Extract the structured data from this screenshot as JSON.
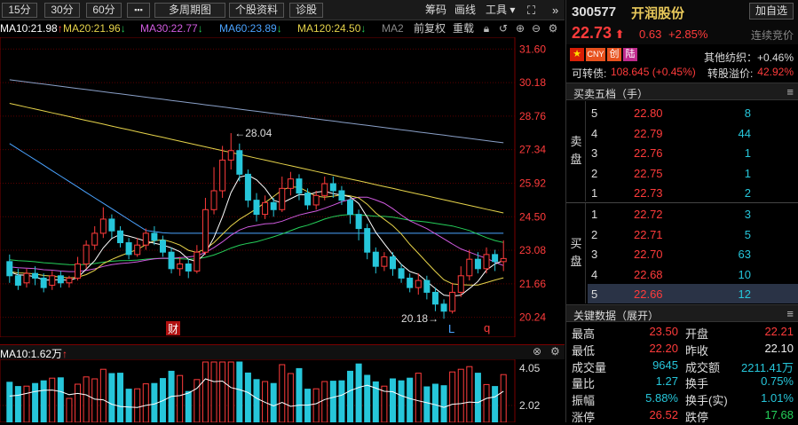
{
  "toolbar": {
    "periods": [
      "15分",
      "30分",
      "60分"
    ],
    "more": "▪▪▪",
    "multi_period": "多周期图",
    "stock_info": "个股资料",
    "diagnose": "诊股",
    "fund": "筹码",
    "draw": "画线",
    "tools": "工具"
  },
  "ma_bar": {
    "ma10": "MA10:21.98",
    "ma20": "MA20:21.96",
    "ma30": "MA30:22.77",
    "ma60": "MA60:23.89",
    "ma120": "MA120:24.50",
    "ma250": "MA2",
    "fq": "前复权",
    "reset": "重载"
  },
  "colors": {
    "up": "#ff3b3b",
    "down": "#26c6da",
    "ma10": "#ffffff",
    "ma20": "#e6d34a",
    "ma30": "#d15be0",
    "ma60": "#4aa3ff",
    "ma120": "#25d05a"
  },
  "chart_data": {
    "type": "candlestick",
    "y_ticks": [
      "31.60",
      "30.18",
      "28.76",
      "27.34",
      "25.92",
      "24.50",
      "23.08",
      "21.66",
      "20.24"
    ],
    "ylim": [
      19.4,
      32.1
    ],
    "annotations": {
      "high": "28.04",
      "low": "20.18"
    },
    "markers": [
      "财",
      "L",
      "q"
    ],
    "candles": [
      [
        22.6,
        22.0,
        22.9,
        21.7
      ],
      [
        22.0,
        21.6,
        22.3,
        21.4
      ],
      [
        21.7,
        22.1,
        22.3,
        21.5
      ],
      [
        22.1,
        21.9,
        22.4,
        21.6
      ],
      [
        21.9,
        21.5,
        22.1,
        21.3
      ],
      [
        21.6,
        22.0,
        22.2,
        21.4
      ],
      [
        22.0,
        21.7,
        22.2,
        21.5
      ],
      [
        21.7,
        21.9,
        22.0,
        21.5
      ],
      [
        21.9,
        22.5,
        22.8,
        21.8
      ],
      [
        22.5,
        23.3,
        23.5,
        22.3
      ],
      [
        23.3,
        23.8,
        24.1,
        23.1
      ],
      [
        23.8,
        24.4,
        24.9,
        23.6
      ],
      [
        24.4,
        23.9,
        24.6,
        23.6
      ],
      [
        23.9,
        23.4,
        24.1,
        23.2
      ],
      [
        23.4,
        22.9,
        23.6,
        22.7
      ],
      [
        22.9,
        23.3,
        23.6,
        22.8
      ],
      [
        23.3,
        23.8,
        24.0,
        23.1
      ],
      [
        23.8,
        23.5,
        24.1,
        23.3
      ],
      [
        23.5,
        23.0,
        23.7,
        22.8
      ],
      [
        23.0,
        22.3,
        23.2,
        22.1
      ],
      [
        22.3,
        22.5,
        22.8,
        22.0
      ],
      [
        22.5,
        22.2,
        22.7,
        21.9
      ],
      [
        22.2,
        23.0,
        23.3,
        22.1
      ],
      [
        23.0,
        24.8,
        25.3,
        22.9
      ],
      [
        24.8,
        25.6,
        26.6,
        24.6
      ],
      [
        25.6,
        26.9,
        27.5,
        25.3
      ],
      [
        26.9,
        27.3,
        28.04,
        26.5
      ],
      [
        27.3,
        26.3,
        27.6,
        26.0
      ],
      [
        26.3,
        25.2,
        26.5,
        24.9
      ],
      [
        25.2,
        24.6,
        25.5,
        24.3
      ],
      [
        24.6,
        25.1,
        25.4,
        24.4
      ],
      [
        25.1,
        24.8,
        25.3,
        24.5
      ],
      [
        24.8,
        25.7,
        26.2,
        24.7
      ],
      [
        25.7,
        26.1,
        26.4,
        25.4
      ],
      [
        26.1,
        25.5,
        26.3,
        25.2
      ],
      [
        25.5,
        25.0,
        25.7,
        24.8
      ],
      [
        25.0,
        25.4,
        25.6,
        24.8
      ],
      [
        25.4,
        25.9,
        26.2,
        25.2
      ],
      [
        25.9,
        25.6,
        26.2,
        25.3
      ],
      [
        25.6,
        25.2,
        25.8,
        25.0
      ],
      [
        25.2,
        24.6,
        25.3,
        24.2
      ],
      [
        24.6,
        24.0,
        24.8,
        23.5
      ],
      [
        24.0,
        23.0,
        24.2,
        22.7
      ],
      [
        23.0,
        22.4,
        23.2,
        22.1
      ],
      [
        22.4,
        22.8,
        23.0,
        22.2
      ],
      [
        22.8,
        22.3,
        23.0,
        22.0
      ],
      [
        22.3,
        21.9,
        22.5,
        21.7
      ],
      [
        21.9,
        21.5,
        22.1,
        21.3
      ],
      [
        21.5,
        21.8,
        22.1,
        21.2
      ],
      [
        21.8,
        21.3,
        22.0,
        21.0
      ],
      [
        21.3,
        20.8,
        21.5,
        20.5
      ],
      [
        20.8,
        20.5,
        21.0,
        20.18
      ],
      [
        20.5,
        21.3,
        21.7,
        20.4
      ],
      [
        21.3,
        22.0,
        22.4,
        21.1
      ],
      [
        22.0,
        22.7,
        23.1,
        21.8
      ],
      [
        22.7,
        22.3,
        23.0,
        22.1
      ],
      [
        22.3,
        22.9,
        23.2,
        22.1
      ],
      [
        22.9,
        22.6,
        23.1,
        22.2
      ],
      [
        22.6,
        22.73,
        23.5,
        22.2
      ]
    ],
    "volume_ticks": [
      "4.05",
      "2.02"
    ],
    "volume_label": "MA10:1.62万"
  },
  "stock": {
    "code": "300577",
    "name": "开润股份",
    "add_label": "加自选",
    "price": "22.73",
    "change": "0.63",
    "pct": "+2.85%",
    "status": "连续竞价",
    "flags": [
      "CNY",
      "创",
      "陆"
    ],
    "sector": "其他纺织：+0.46%",
    "bond_label": "可转债:",
    "bond_value": "108.645 (+0.45%)",
    "premium_label": "转股溢价:",
    "premium_value": "42.92%"
  },
  "orderbook": {
    "title": "买卖五档（手）",
    "sell_label": "卖盘",
    "buy_label": "买盘",
    "sells": [
      {
        "lvl": "5",
        "p": "22.80",
        "q": "8"
      },
      {
        "lvl": "4",
        "p": "22.79",
        "q": "44"
      },
      {
        "lvl": "3",
        "p": "22.76",
        "q": "1"
      },
      {
        "lvl": "2",
        "p": "22.75",
        "q": "1"
      },
      {
        "lvl": "1",
        "p": "22.73",
        "q": "2"
      }
    ],
    "buys": [
      {
        "lvl": "1",
        "p": "22.72",
        "q": "3"
      },
      {
        "lvl": "2",
        "p": "22.71",
        "q": "5"
      },
      {
        "lvl": "3",
        "p": "22.70",
        "q": "63"
      },
      {
        "lvl": "4",
        "p": "22.68",
        "q": "10"
      },
      {
        "lvl": "5",
        "p": "22.66",
        "q": "12"
      }
    ]
  },
  "keydata": {
    "title": "关键数据（展开）",
    "rows": [
      {
        "l1": "最高",
        "v1": "23.50",
        "c1": "red",
        "l2": "开盘",
        "v2": "22.21",
        "c2": "red"
      },
      {
        "l1": "最低",
        "v1": "22.20",
        "c1": "red",
        "l2": "昨收",
        "v2": "22.10",
        "c2": "white"
      },
      {
        "l1": "成交量",
        "v1": "9645",
        "c1": "cyan",
        "l2": "成交额",
        "v2": "2211.41万",
        "c2": "cyan"
      },
      {
        "l1": "量比",
        "v1": "1.27",
        "c1": "cyan",
        "l2": "换手",
        "v2": "0.75%",
        "c2": "cyan"
      },
      {
        "l1": "振幅",
        "v1": "5.88%",
        "c1": "cyan",
        "l2": "换手(实)",
        "v2": "1.01%",
        "c2": "cyan"
      },
      {
        "l1": "涨停",
        "v1": "26.52",
        "c1": "red",
        "l2": "跌停",
        "v2": "17.68",
        "c2": "green"
      }
    ]
  }
}
